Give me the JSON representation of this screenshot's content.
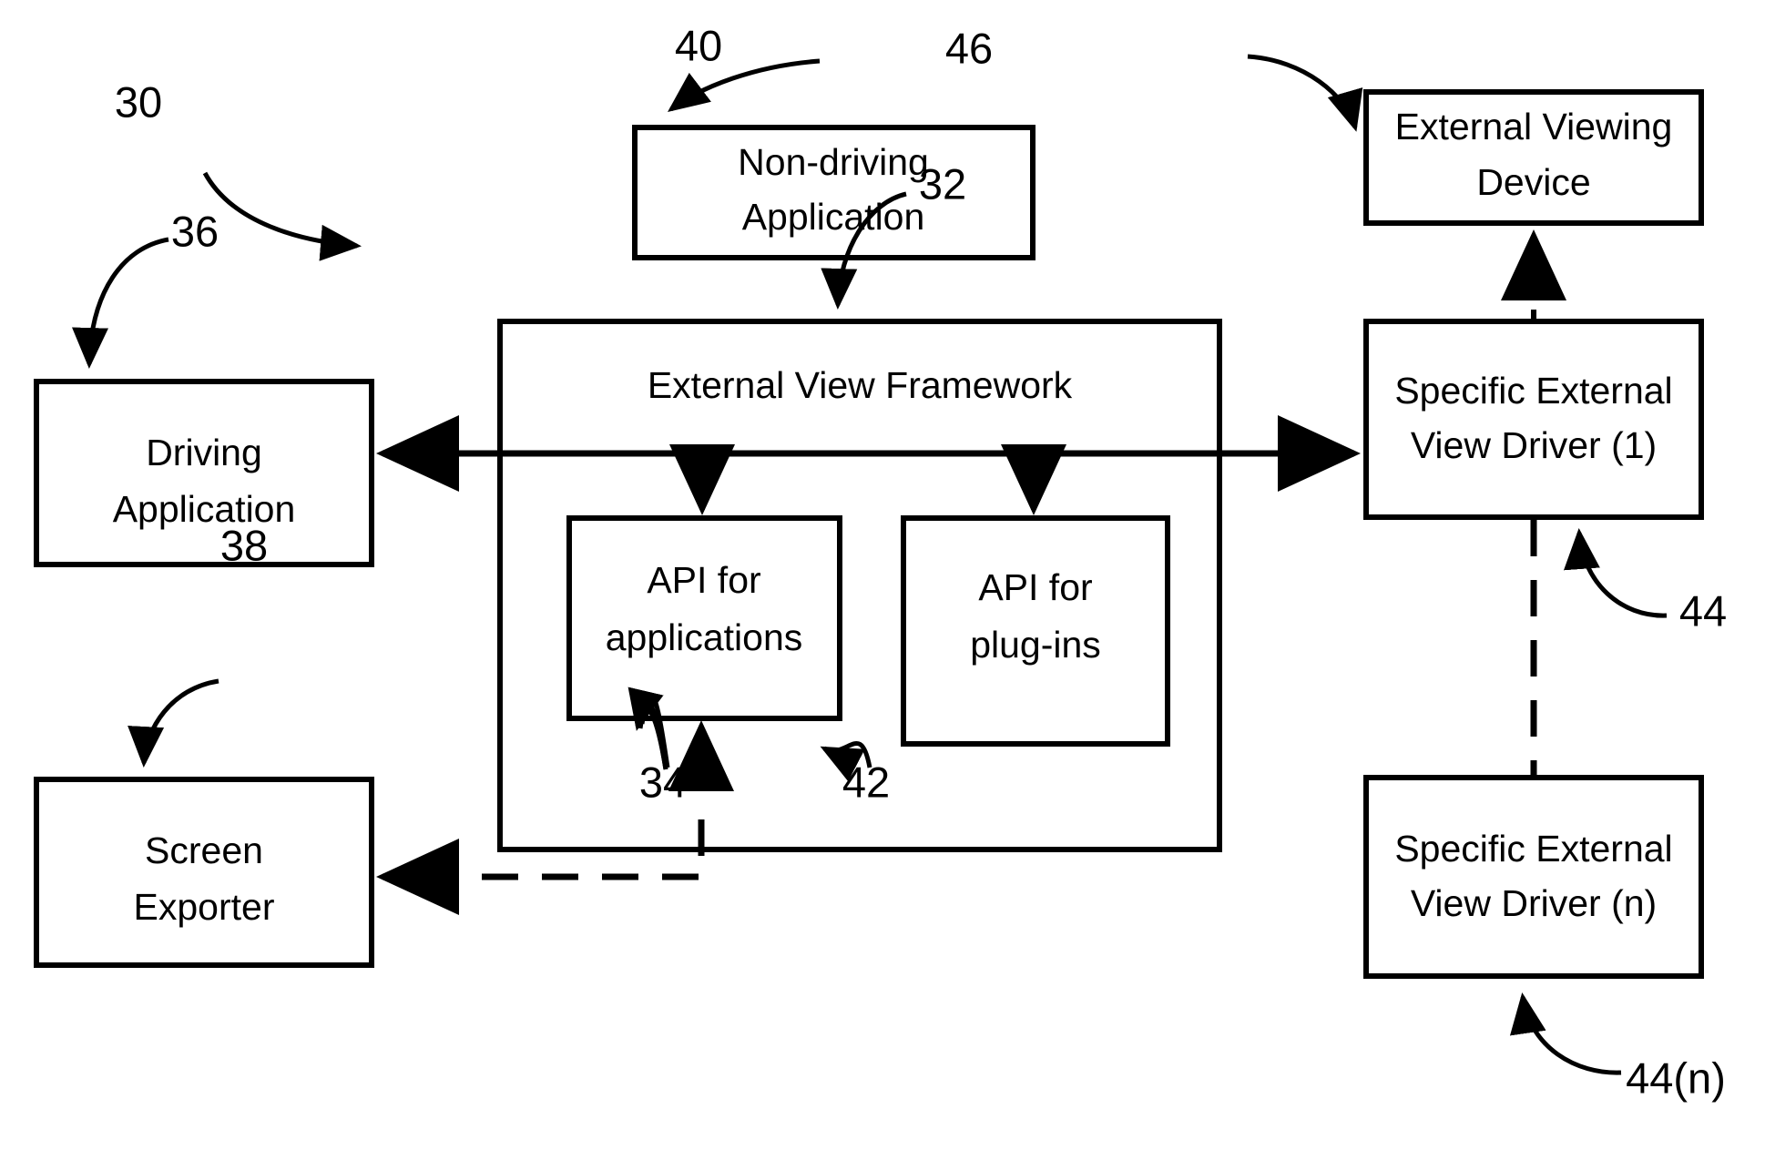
{
  "figure": {
    "type": "patent-block-diagram",
    "background_color": "#ffffff",
    "line_color": "#000000"
  },
  "boxes": {
    "non_driving_application": "Non-driving\nApplication",
    "non_driving_application_line1": "Non-driving",
    "non_driving_application_line2": "Application",
    "driving_application_line1": "Driving",
    "driving_application_line2": "Application",
    "screen_exporter_line1": "Screen",
    "screen_exporter_line2": "Exporter",
    "external_view_framework": "External View Framework",
    "api_for_applications_line1": "API for",
    "api_for_applications_line2": "applications",
    "api_for_plugins_line1": "API for",
    "api_for_plugins_line2": "plug-ins",
    "external_viewing_device_line1": "External Viewing",
    "external_viewing_device_line2": "Device",
    "driver_1_line1": "Specific External",
    "driver_1_line2": "View Driver (1)",
    "driver_n_line1": "Specific External",
    "driver_n_line2": "View Driver (n)"
  },
  "reference_numerals": {
    "system": "30",
    "framework": "32",
    "api_applications": "34",
    "driving_application": "36",
    "screen_exporter": "38",
    "non_driving_application": "40",
    "api_plugins": "42",
    "driver_1": "44",
    "driver_n": "44(n)",
    "external_viewing_device": "46"
  }
}
